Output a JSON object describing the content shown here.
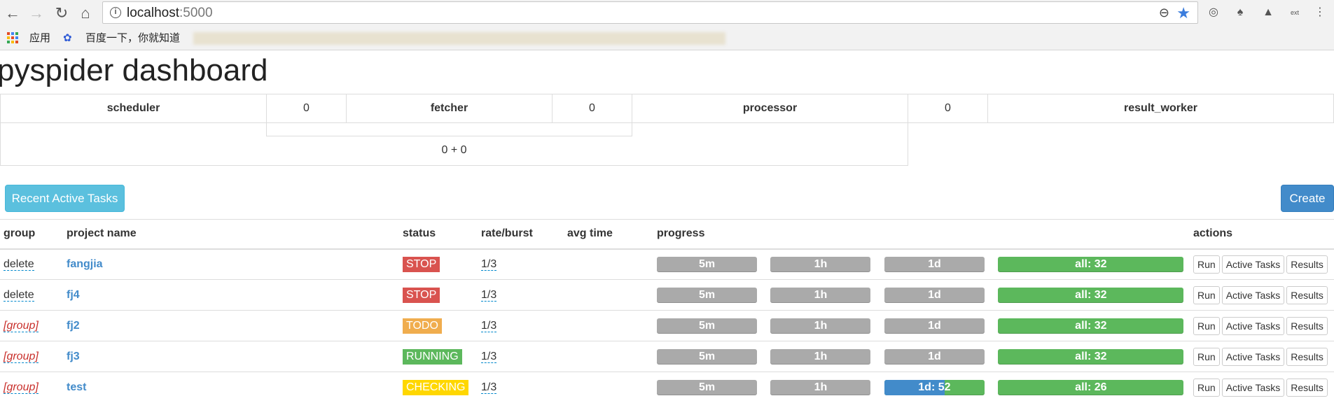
{
  "browser": {
    "url_host": "localhost",
    "url_port": ":5000",
    "bookmarks": [
      {
        "label": "应用"
      },
      {
        "label": "百度一下，你就知道"
      }
    ]
  },
  "page": {
    "title": "pyspider dashboard"
  },
  "stats": {
    "scheduler_label": "scheduler",
    "scheduler_value": "0",
    "fetcher_label": "fetcher",
    "fetcher_value": "0",
    "processor_label": "processor",
    "processor_value": "0",
    "result_worker_label": "result_worker",
    "queue_sum": "0 + 0"
  },
  "actions": {
    "recent_tasks": "Recent Active Tasks",
    "create": "Create"
  },
  "table": {
    "headers": {
      "group": "group",
      "project_name": "project name",
      "status": "status",
      "rate_burst": "rate/burst",
      "avg_time": "avg time",
      "progress": "progress",
      "actions": "actions"
    },
    "rows": [
      {
        "group": "delete",
        "name": "fangjia",
        "status": "STOP",
        "rate": "1/3",
        "p5m": "5m",
        "p1h": "1h",
        "p1d": "1d",
        "pall": "all: 32",
        "run": "Run",
        "active": "Active Tasks",
        "results": "Results"
      },
      {
        "group": "delete",
        "name": "fj4",
        "status": "STOP",
        "rate": "1/3",
        "p5m": "5m",
        "p1h": "1h",
        "p1d": "1d",
        "pall": "all: 32",
        "run": "Run",
        "active": "Active Tasks",
        "results": "Results"
      },
      {
        "group": "[group]",
        "name": "fj2",
        "status": "TODO",
        "rate": "1/3",
        "p5m": "5m",
        "p1h": "1h",
        "p1d": "1d",
        "pall": "all: 32",
        "run": "Run",
        "active": "Active Tasks",
        "results": "Results"
      },
      {
        "group": "[group]",
        "name": "fj3",
        "status": "RUNNING",
        "rate": "1/3",
        "p5m": "5m",
        "p1h": "1h",
        "p1d": "1d",
        "pall": "all: 32",
        "run": "Run",
        "active": "Active Tasks",
        "results": "Results"
      },
      {
        "group": "[group]",
        "name": "test",
        "status": "CHECKING",
        "rate": "1/3",
        "p5m": "5m",
        "p1h": "1h",
        "p1d": "1d: 52",
        "pall": "all: 26",
        "run": "Run",
        "active": "Active Tasks",
        "results": "Results"
      }
    ]
  },
  "colors": {
    "stop": "#d9534f",
    "todo": "#f0ad4e",
    "running": "#5cb85c",
    "checking": "#ffd700",
    "progress_gray": "#aaaaaa",
    "progress_green": "#5cb85c",
    "progress_blue": "#428bca"
  },
  "icons": {
    "back": "arrow-left-icon",
    "forward": "arrow-right-icon",
    "reload": "reload-icon",
    "home": "home-icon"
  }
}
